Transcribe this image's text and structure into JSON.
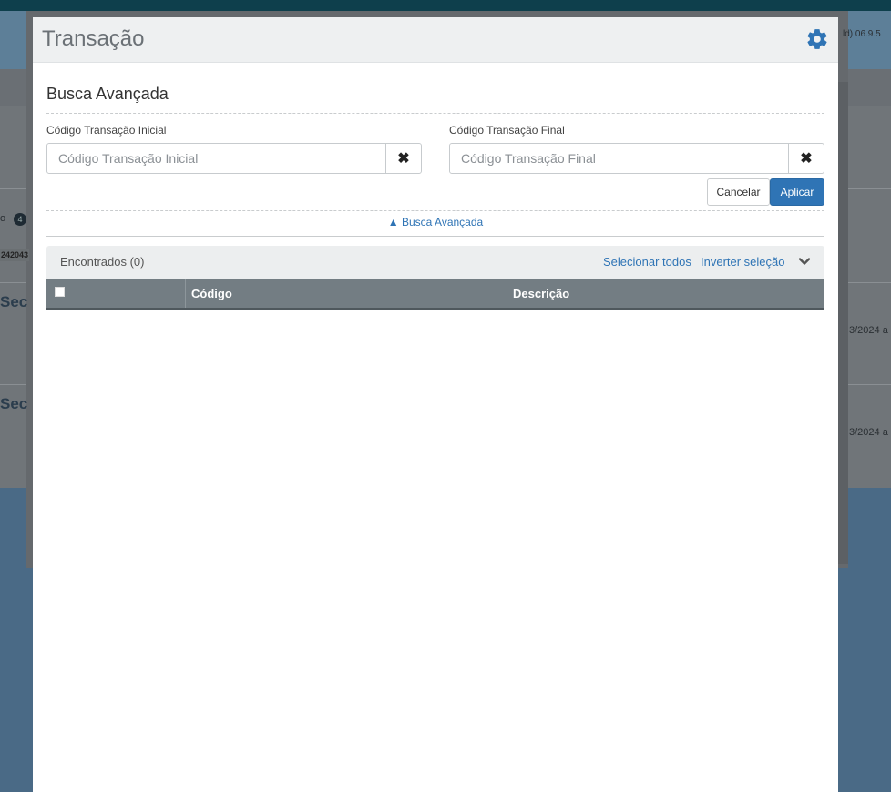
{
  "background": {
    "version_text": "ld) 06.9.5",
    "badge_prefix": "o",
    "badge_count": "4",
    "chip_text": "242043",
    "heading_1": "Sec",
    "heading_2": "Sec",
    "date_1": "3/2024 a",
    "date_2": "3/2024 a"
  },
  "modal": {
    "title": "Transação",
    "settings_icon": "gear-icon",
    "section_title": "Busca Avançada",
    "fields": {
      "initial_label": "Código Transação Inicial",
      "initial_placeholder": "Código Transação Inicial",
      "final_label": "Código Transação Final",
      "final_placeholder": "Código Transação Final",
      "clear_glyph": "✖"
    },
    "buttons": {
      "cancel": "Cancelar",
      "apply": "Aplicar"
    },
    "toggle_link": "▲ Busca Avançada",
    "results": {
      "found_label": "Encontrados (0)",
      "select_all": "Selecionar todos",
      "invert_selection": "Inverter seleção"
    },
    "grid": {
      "columns": [
        "Código",
        "Descrição"
      ],
      "rows": []
    }
  },
  "colors": {
    "accent": "#2f74b5",
    "grid_header": "#737d83",
    "header_bg": "#eef0f1"
  }
}
